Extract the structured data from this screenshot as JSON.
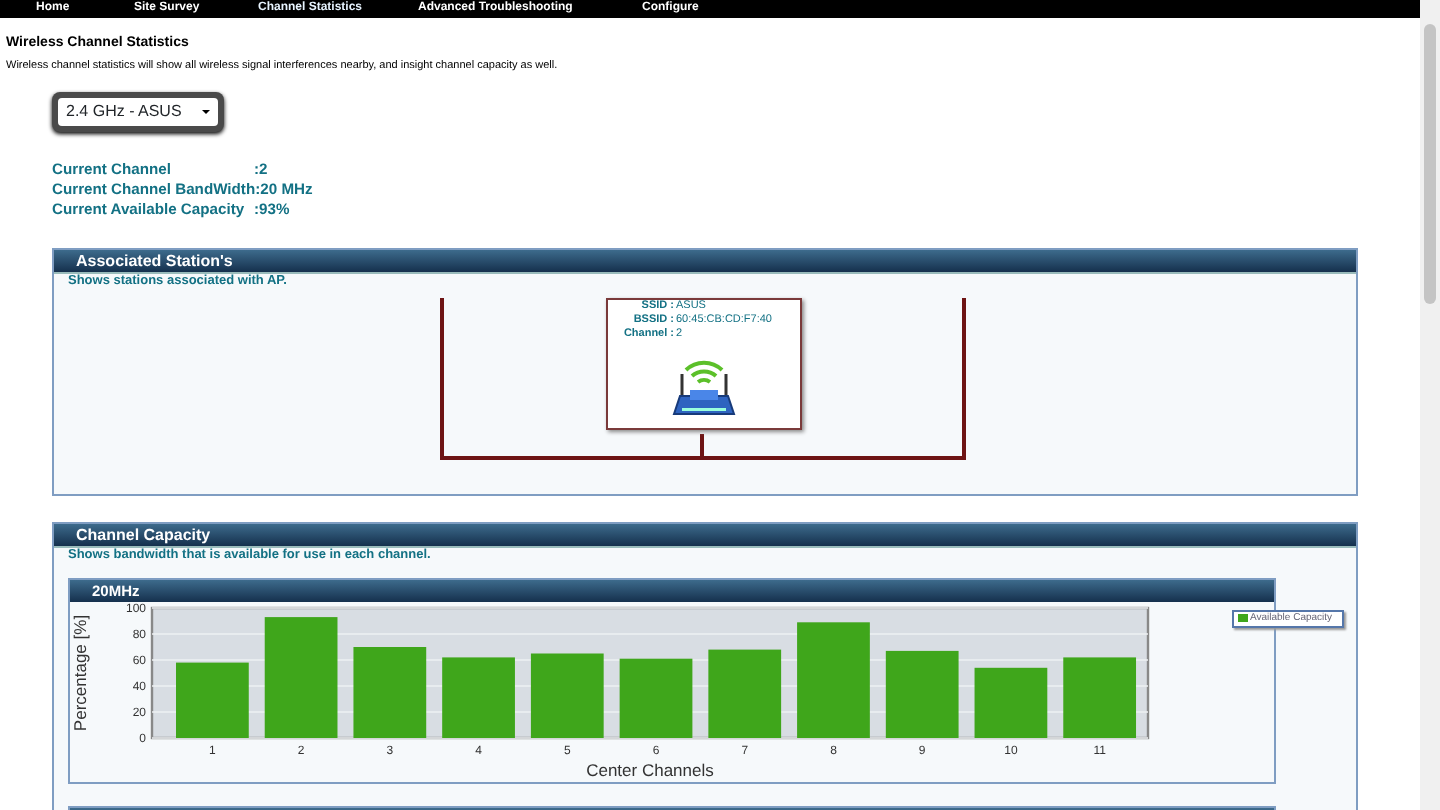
{
  "nav": [
    {
      "label": "Home",
      "selected": false
    },
    {
      "label": "Site Survey",
      "selected": false
    },
    {
      "label": "Channel Statistics",
      "selected": true
    },
    {
      "label": "Advanced Troubleshooting",
      "selected": false
    },
    {
      "label": "Configure",
      "selected": false
    }
  ],
  "page": {
    "title": "Wireless Channel Statistics",
    "description": "Wireless channel statistics will show all wireless signal interferences nearby, and insight channel capacity as well."
  },
  "band_select": {
    "value": "2.4 GHz - ASUS"
  },
  "info": [
    {
      "label": "Current Channel",
      "value": ":2"
    },
    {
      "label": "Current Channel BandWidth",
      "value": ":20 MHz"
    },
    {
      "label": "Current Available Capacity",
      "value": ":93%"
    }
  ],
  "associated": {
    "title": "Associated Station's",
    "subtitle": "Shows stations associated with AP.",
    "ap": [
      {
        "label": "SSID :",
        "value": "ASUS"
      },
      {
        "label": "BSSID :",
        "value": "60:45:CB:CD:F7:40"
      },
      {
        "label": "Channel :",
        "value": "2"
      }
    ]
  },
  "capacity": {
    "title": "Channel Capacity",
    "subtitle": "Shows bandwidth that is available for use in each channel.",
    "panels": [
      {
        "title": "20MHz",
        "chart_data": {
          "type": "bar",
          "xlabel": "Center Channels",
          "ylabel": "Percentage [%]",
          "categories": [
            "1",
            "2",
            "3",
            "4",
            "5",
            "6",
            "7",
            "8",
            "9",
            "10",
            "11"
          ],
          "series": [
            {
              "name": "Available Capacity",
              "color": "#3fa61b",
              "values": [
                58,
                93,
                70,
                62,
                65,
                61,
                68,
                89,
                67,
                54,
                62
              ]
            }
          ],
          "ylim": [
            0,
            100
          ],
          "grid": true,
          "yticks": [
            0,
            20,
            40,
            60,
            80,
            100
          ]
        }
      }
    ]
  }
}
